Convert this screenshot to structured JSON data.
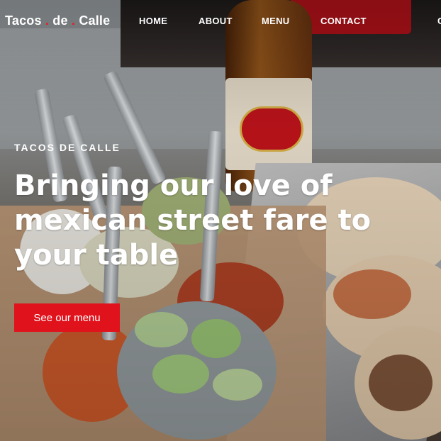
{
  "nav": {
    "brand": {
      "part1": "Tacos",
      "dot": ".",
      "part2": "de",
      "part3": "Calle"
    },
    "links": [
      "HOME",
      "ABOUT",
      "MENU",
      "CONTACT"
    ],
    "cut_off_item": "C"
  },
  "hero": {
    "eyebrow": "TACOS DE CALLE",
    "headline": "Bringing our love of mexican street fare to your table",
    "cta_label": "See our menu",
    "image_alt_tag": "tacos-and-salsas-photo"
  },
  "colors": {
    "accent": "#e0121c",
    "brand_dot": "#e11f2b",
    "text": "#ffffff"
  }
}
